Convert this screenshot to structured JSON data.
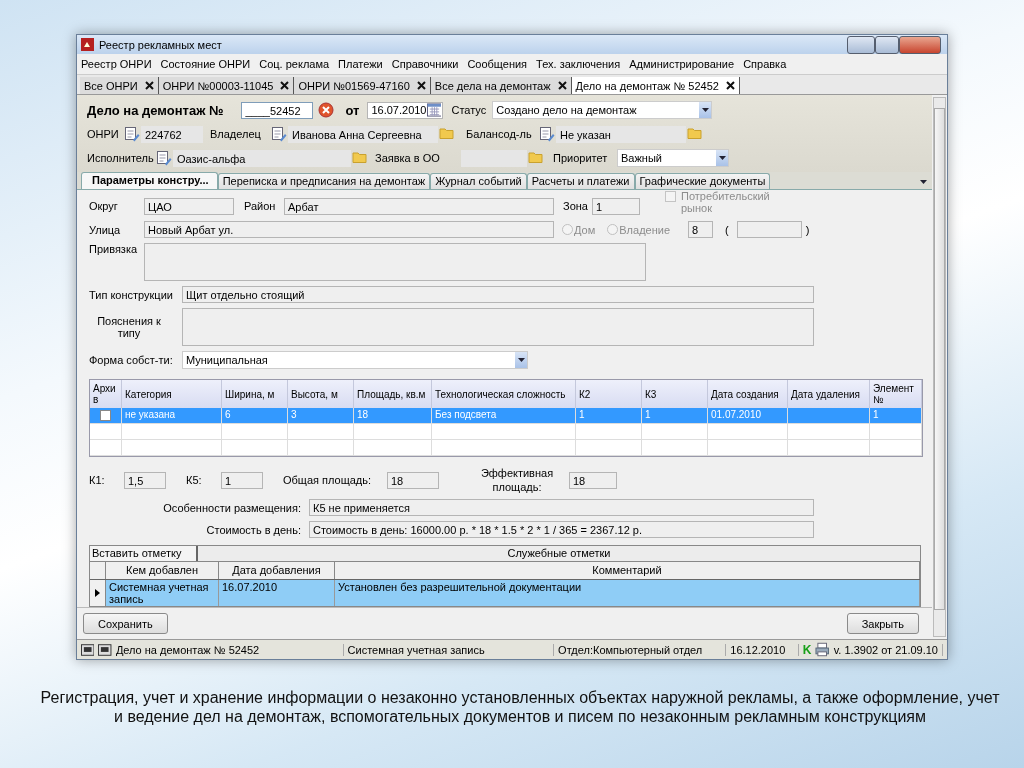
{
  "window": {
    "title": "Реестр рекламных мест"
  },
  "menu": [
    "Реестр ОНРИ",
    "Состояние ОНРИ",
    "Соц. реклама",
    "Платежи",
    "Справочники",
    "Сообщения",
    "Тех. заключения",
    "Администрирование",
    "Справка"
  ],
  "doc_tabs": [
    {
      "label": "Все ОНРИ",
      "selected": false
    },
    {
      "label": "ОНРИ №00003-11045",
      "selected": false
    },
    {
      "label": "ОНРИ №01569-47160",
      "selected": false
    },
    {
      "label": "Все дела на демонтаж",
      "selected": false
    },
    {
      "label": "Дело на демонтаж № 52452",
      "selected": true
    }
  ],
  "header": {
    "title": "Дело на демонтаж №",
    "number": "____52452",
    "date_label": "от",
    "date": "16.07.2010",
    "status_label": "Статус",
    "status": "Создано дело на демонтаж",
    "onri_label": "ОНРИ",
    "onri": "224762",
    "owner_label": "Владелец",
    "owner": "Иванова Анна Сергеевна",
    "balance_label": "Балансод-ль",
    "balance": "Не указан",
    "executor_label": "Исполнитель",
    "executor": "Оазис-альфа",
    "request_label": "Заявка в ОО",
    "priority_label": "Приоритет",
    "priority": "Важный"
  },
  "section_tabs": [
    {
      "label": "Параметры  констру...",
      "selected": true
    },
    {
      "label": "Переписка и предписания на демонтаж",
      "selected": false
    },
    {
      "label": "Журнал событий",
      "selected": false
    },
    {
      "label": "Расчеты и платежи",
      "selected": false
    },
    {
      "label": "Графические документы",
      "selected": false
    }
  ],
  "form": {
    "district_label": "Округ",
    "district": "ЦАО",
    "area_label": "Район",
    "area": "Арбат",
    "zone_label": "Зона",
    "zone": "1",
    "market": {
      "label": "Потребительский рынок",
      "checked": false,
      "disabled": true
    },
    "street_label": "Улица",
    "street": "Новый Арбат ул.",
    "radios": [
      {
        "label": "Дом",
        "checked": false,
        "disabled": true
      },
      {
        "label": "Владение",
        "checked": false,
        "disabled": true
      }
    ],
    "house": "8",
    "open_paren": "(",
    "close_paren": ")",
    "binding_label": "Привязка",
    "type_label": "Тип конструкции",
    "type": "Щит отдельно стоящий",
    "type_notes_label": "Пояснения к типу",
    "ownership_label": "Форма собст-ти:",
    "ownership": "Муниципальная"
  },
  "table": {
    "columns": [
      "Архи в",
      "Категория",
      "Ширина, м",
      "Высота, м",
      "Площадь, кв.м",
      "Технологическая сложность",
      "К2",
      "К3",
      "Дата создания",
      "Дата удаления",
      "Элемент №"
    ],
    "rows": [
      {
        "archived": false,
        "selected": true,
        "cells": [
          "",
          "не указана",
          "6",
          "3",
          "18",
          "Без подсвета",
          "1",
          "1",
          "01.07.2010",
          "",
          "1"
        ]
      }
    ]
  },
  "totals": {
    "k1_label": "К1:",
    "k1": "1,5",
    "k5_label": "К5:",
    "k5": "1",
    "total_label": "Общая площадь:",
    "total": "18",
    "effective_label": "Эффективная площадь:",
    "effective": "18",
    "placement_label": "Особенности размещения:",
    "placement": "К5 не применяется",
    "cost_label": "Стоимость в день:",
    "cost": "Стоимость в день: 16000.00 р. * 18 * 1.5 * 2 * 1 / 365 = 2367.12 р."
  },
  "notes": {
    "insert_button": "Вставить отметку",
    "title": "Служебные отметки",
    "columns": [
      "Кем добавлен",
      "Дата добавления",
      "Комментарий"
    ],
    "rows": [
      {
        "selected": true,
        "cells": [
          "Системная учетная запись",
          "16.07.2010",
          "Установлен без разрешительной документации"
        ]
      }
    ]
  },
  "buttons": {
    "save": "Сохранить",
    "close": "Закрыть"
  },
  "status_bar": [
    {
      "kind": "text",
      "text": "Дело на демонтаж № 52452"
    },
    {
      "kind": "text",
      "text": "Системная учетная запись"
    },
    {
      "kind": "text",
      "text": "Отдел:Компьютерный отдел"
    },
    {
      "kind": "text",
      "text": "16.12.2010"
    },
    {
      "kind": "letter",
      "text": "K"
    },
    {
      "kind": "text",
      "text": "v. 1.3902 от 21.09.10"
    }
  ],
  "caption": "Регистрация, учет и хранение информации о незаконно установленных объектах наружной рекламы, а также оформление, учет и ведение дел на демонтаж, вспомогательных документов и писем по незаконным рекламным конструкциям"
}
